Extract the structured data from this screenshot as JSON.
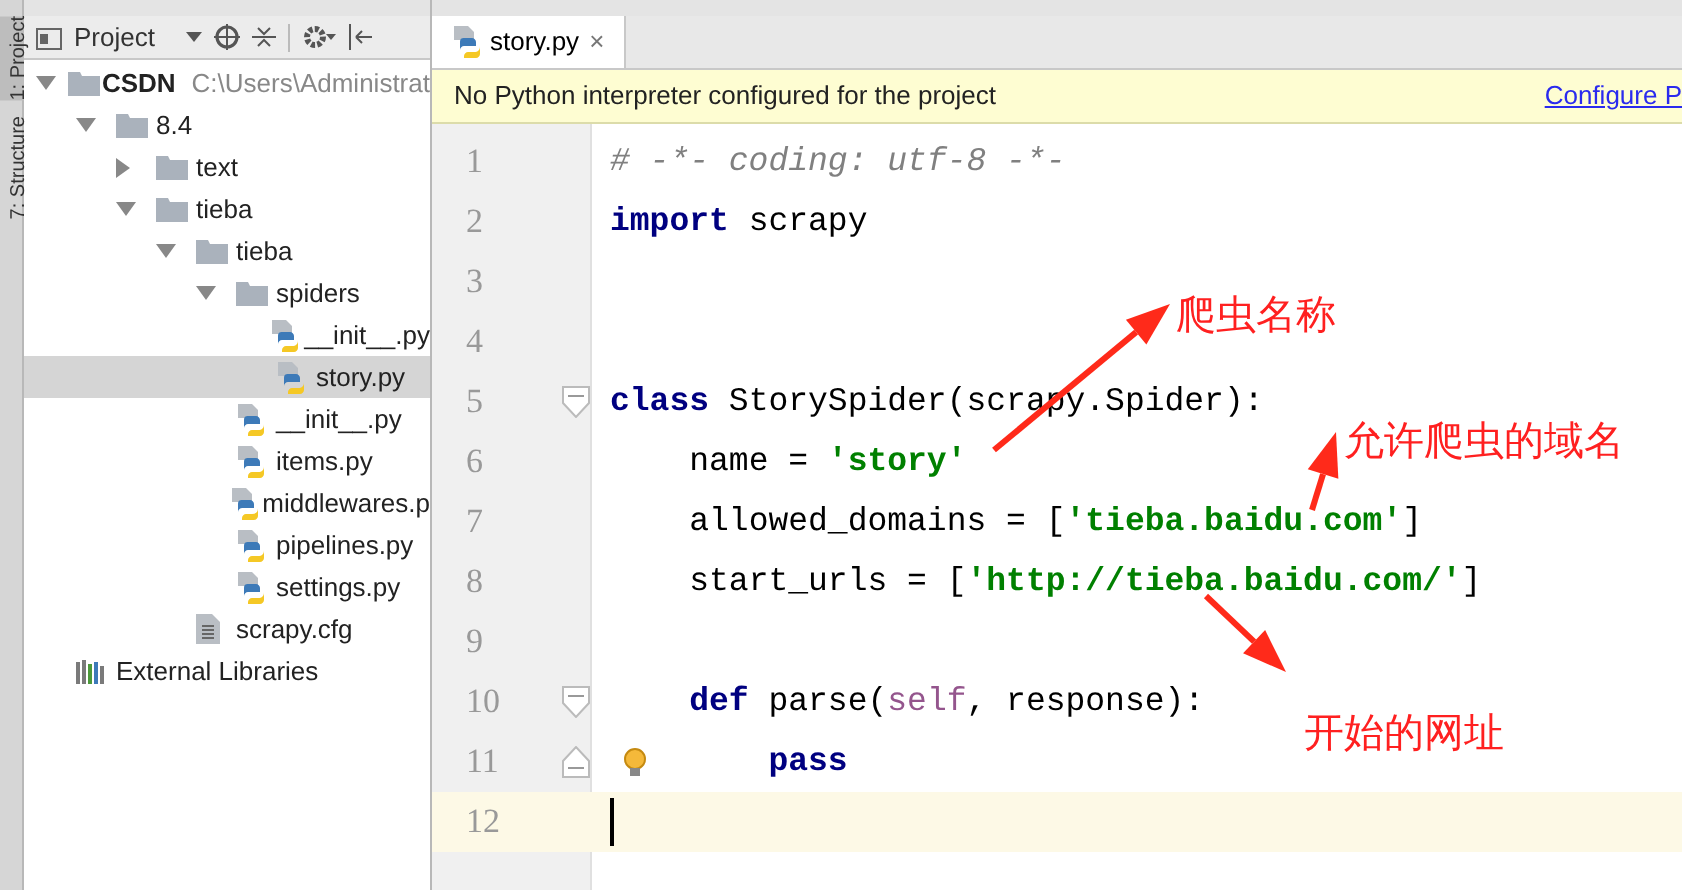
{
  "tool_strip": [
    {
      "label": "1: Project",
      "selected": true
    },
    {
      "label": "7: Structure",
      "selected": false
    }
  ],
  "project_panel": {
    "title": "Project"
  },
  "tree": [
    {
      "label": "CSDN",
      "hint": "C:\\Users\\Administrat",
      "kind": "folder",
      "expanded": true,
      "selected": false,
      "children": [
        {
          "label": "8.4",
          "kind": "folder",
          "expanded": true,
          "selected": false,
          "children": [
            {
              "label": "text",
              "kind": "folder",
              "expanded": false,
              "selected": false
            },
            {
              "label": "tieba",
              "kind": "folder",
              "expanded": true,
              "selected": false,
              "children": [
                {
                  "label": "tieba",
                  "kind": "folder",
                  "expanded": true,
                  "selected": false,
                  "children": [
                    {
                      "label": "spiders",
                      "kind": "folder",
                      "expanded": true,
                      "selected": false,
                      "children": [
                        {
                          "label": "__init__.py",
                          "kind": "python",
                          "selected": false
                        },
                        {
                          "label": "story.py",
                          "kind": "python",
                          "selected": true
                        }
                      ]
                    },
                    {
                      "label": "__init__.py",
                      "kind": "python",
                      "selected": false
                    },
                    {
                      "label": "items.py",
                      "kind": "python",
                      "selected": false
                    },
                    {
                      "label": "middlewares.p",
                      "kind": "python",
                      "selected": false
                    },
                    {
                      "label": "pipelines.py",
                      "kind": "python",
                      "selected": false
                    },
                    {
                      "label": "settings.py",
                      "kind": "python",
                      "selected": false
                    }
                  ]
                },
                {
                  "label": "scrapy.cfg",
                  "kind": "file",
                  "selected": false
                }
              ]
            }
          ]
        }
      ]
    },
    {
      "label": "External Libraries",
      "kind": "library",
      "selected": false
    }
  ],
  "editor_tabs": [
    {
      "label": "story.py",
      "close": "×",
      "selected": true
    }
  ],
  "banner": {
    "message": "No Python interpreter configured for the project",
    "link": "Configure P"
  },
  "code_lines": [
    {
      "number": "1",
      "tokens": [
        {
          "kind": "comment",
          "text": "# -*- coding: utf-8 -*-"
        }
      ]
    },
    {
      "number": "2",
      "tokens": [
        {
          "kind": "keyword",
          "text": "import"
        },
        {
          "kind": "plain",
          "text": " scrapy"
        }
      ]
    },
    {
      "number": "3"
    },
    {
      "number": "4"
    },
    {
      "number": "5",
      "fold_start": true,
      "tokens": [
        {
          "kind": "keyword",
          "text": "class"
        },
        {
          "kind": "plain",
          "text": " StorySpider(scrapy.Spider):"
        }
      ]
    },
    {
      "number": "6",
      "tokens": [
        {
          "kind": "plain",
          "text": "    name = "
        },
        {
          "kind": "string",
          "text": "'story'"
        }
      ]
    },
    {
      "number": "7",
      "tokens": [
        {
          "kind": "plain",
          "text": "    allowed_domains = ["
        },
        {
          "kind": "string",
          "text": "'tieba.baidu.com'"
        },
        {
          "kind": "plain",
          "text": "]"
        }
      ]
    },
    {
      "number": "8",
      "tokens": [
        {
          "kind": "plain",
          "text": "    start_urls = ["
        },
        {
          "kind": "string",
          "text": "'http://tieba.baidu.com/'"
        },
        {
          "kind": "plain",
          "text": "]"
        }
      ]
    },
    {
      "number": "9"
    },
    {
      "number": "10",
      "fold_start": true,
      "tokens": [
        {
          "kind": "keyword",
          "text": "    def"
        },
        {
          "kind": "plain",
          "text": " parse("
        },
        {
          "kind": "self",
          "text": "self"
        },
        {
          "kind": "plain",
          "text": ", response):"
        }
      ]
    },
    {
      "number": "11",
      "fold_end": true,
      "bulb": true,
      "tokens": [
        {
          "kind": "keyword",
          "text": "        pass"
        }
      ]
    },
    {
      "number": "12",
      "current": true
    }
  ],
  "annotations": [
    {
      "text": "爬虫名称"
    },
    {
      "text": "允许爬虫的域名"
    },
    {
      "text": "开始的网址"
    }
  ]
}
